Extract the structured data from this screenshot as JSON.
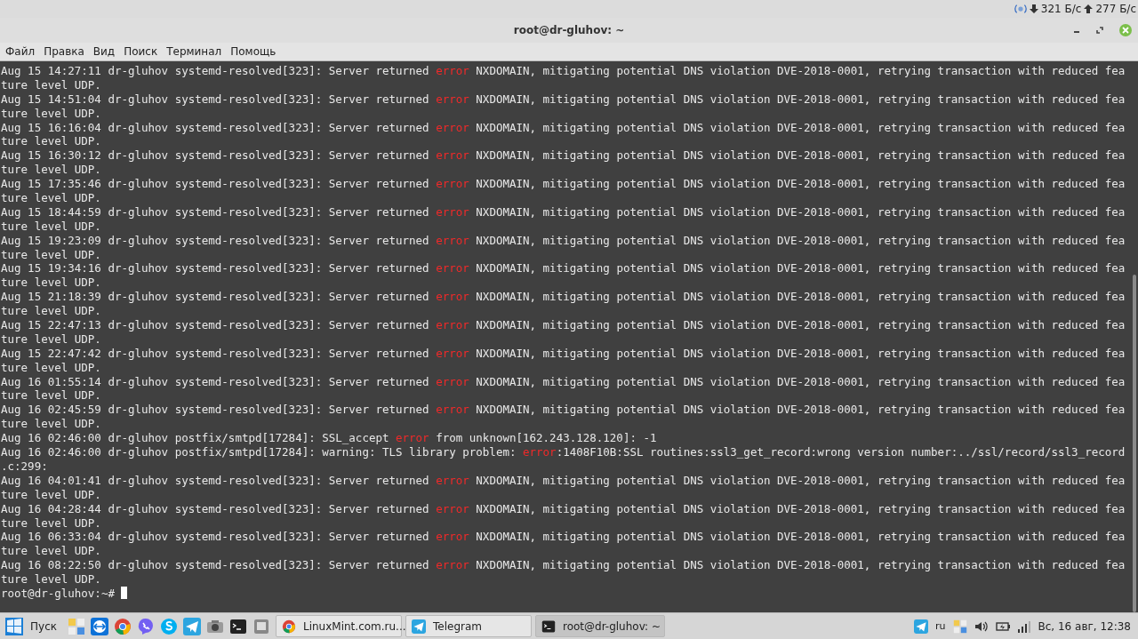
{
  "top_panel": {
    "download": "321 Б/с",
    "upload": "277 Б/с"
  },
  "window": {
    "title": "root@dr-gluhov: ~"
  },
  "menu": [
    "Файл",
    "Правка",
    "Вид",
    "Поиск",
    "Терминал",
    "Помощь"
  ],
  "terminal": {
    "rows": [
      {
        "pre": "Aug 15 14:27:11 dr-gluhov systemd-resolved[323]: Server returned ",
        "err": "error",
        "post": " NXDOMAIN, mitigating potential DNS violation DVE-2018-0001, retrying transaction with reduced fea"
      },
      {
        "pre": "ture level UDP."
      },
      {
        "pre": "Aug 15 14:51:04 dr-gluhov systemd-resolved[323]: Server returned ",
        "err": "error",
        "post": " NXDOMAIN, mitigating potential DNS violation DVE-2018-0001, retrying transaction with reduced fea"
      },
      {
        "pre": "ture level UDP."
      },
      {
        "pre": "Aug 15 16:16:04 dr-gluhov systemd-resolved[323]: Server returned ",
        "err": "error",
        "post": " NXDOMAIN, mitigating potential DNS violation DVE-2018-0001, retrying transaction with reduced fea"
      },
      {
        "pre": "ture level UDP."
      },
      {
        "pre": "Aug 15 16:30:12 dr-gluhov systemd-resolved[323]: Server returned ",
        "err": "error",
        "post": " NXDOMAIN, mitigating potential DNS violation DVE-2018-0001, retrying transaction with reduced fea"
      },
      {
        "pre": "ture level UDP."
      },
      {
        "pre": "Aug 15 17:35:46 dr-gluhov systemd-resolved[323]: Server returned ",
        "err": "error",
        "post": " NXDOMAIN, mitigating potential DNS violation DVE-2018-0001, retrying transaction with reduced fea"
      },
      {
        "pre": "ture level UDP."
      },
      {
        "pre": "Aug 15 18:44:59 dr-gluhov systemd-resolved[323]: Server returned ",
        "err": "error",
        "post": " NXDOMAIN, mitigating potential DNS violation DVE-2018-0001, retrying transaction with reduced fea"
      },
      {
        "pre": "ture level UDP."
      },
      {
        "pre": "Aug 15 19:23:09 dr-gluhov systemd-resolved[323]: Server returned ",
        "err": "error",
        "post": " NXDOMAIN, mitigating potential DNS violation DVE-2018-0001, retrying transaction with reduced fea"
      },
      {
        "pre": "ture level UDP."
      },
      {
        "pre": "Aug 15 19:34:16 dr-gluhov systemd-resolved[323]: Server returned ",
        "err": "error",
        "post": " NXDOMAIN, mitigating potential DNS violation DVE-2018-0001, retrying transaction with reduced fea"
      },
      {
        "pre": "ture level UDP."
      },
      {
        "pre": "Aug 15 21:18:39 dr-gluhov systemd-resolved[323]: Server returned ",
        "err": "error",
        "post": " NXDOMAIN, mitigating potential DNS violation DVE-2018-0001, retrying transaction with reduced fea"
      },
      {
        "pre": "ture level UDP."
      },
      {
        "pre": "Aug 15 22:47:13 dr-gluhov systemd-resolved[323]: Server returned ",
        "err": "error",
        "post": " NXDOMAIN, mitigating potential DNS violation DVE-2018-0001, retrying transaction with reduced fea"
      },
      {
        "pre": "ture level UDP."
      },
      {
        "pre": "Aug 15 22:47:42 dr-gluhov systemd-resolved[323]: Server returned ",
        "err": "error",
        "post": " NXDOMAIN, mitigating potential DNS violation DVE-2018-0001, retrying transaction with reduced fea"
      },
      {
        "pre": "ture level UDP."
      },
      {
        "pre": "Aug 16 01:55:14 dr-gluhov systemd-resolved[323]: Server returned ",
        "err": "error",
        "post": " NXDOMAIN, mitigating potential DNS violation DVE-2018-0001, retrying transaction with reduced fea"
      },
      {
        "pre": "ture level UDP."
      },
      {
        "pre": "Aug 16 02:45:59 dr-gluhov systemd-resolved[323]: Server returned ",
        "err": "error",
        "post": " NXDOMAIN, mitigating potential DNS violation DVE-2018-0001, retrying transaction with reduced fea"
      },
      {
        "pre": "ture level UDP."
      },
      {
        "pre": "Aug 16 02:46:00 dr-gluhov postfix/smtpd[17284]: SSL_accept ",
        "err": "error",
        "post": " from unknown[162.243.128.120]: -1"
      },
      {
        "pre": "Aug 16 02:46:00 dr-gluhov postfix/smtpd[17284]: warning: TLS library problem: ",
        "err": "error",
        "post": ":1408F10B:SSL routines:ssl3_get_record:wrong version number:../ssl/record/ssl3_record"
      },
      {
        "pre": ".c:299:"
      },
      {
        "pre": "Aug 16 04:01:41 dr-gluhov systemd-resolved[323]: Server returned ",
        "err": "error",
        "post": " NXDOMAIN, mitigating potential DNS violation DVE-2018-0001, retrying transaction with reduced fea"
      },
      {
        "pre": "ture level UDP."
      },
      {
        "pre": "Aug 16 04:28:44 dr-gluhov systemd-resolved[323]: Server returned ",
        "err": "error",
        "post": " NXDOMAIN, mitigating potential DNS violation DVE-2018-0001, retrying transaction with reduced fea"
      },
      {
        "pre": "ture level UDP."
      },
      {
        "pre": "Aug 16 06:33:04 dr-gluhov systemd-resolved[323]: Server returned ",
        "err": "error",
        "post": " NXDOMAIN, mitigating potential DNS violation DVE-2018-0001, retrying transaction with reduced fea"
      },
      {
        "pre": "ture level UDP."
      },
      {
        "pre": "Aug 16 08:22:50 dr-gluhov systemd-resolved[323]: Server returned ",
        "err": "error",
        "post": " NXDOMAIN, mitigating potential DNS violation DVE-2018-0001, retrying transaction with reduced fea"
      },
      {
        "pre": "ture level UDP."
      }
    ],
    "prompt": "root@dr-gluhov:~# "
  },
  "taskbar": {
    "start": "Пуск",
    "windows": [
      {
        "kind": "browser",
        "label": "LinuxMint.com.ru...",
        "selected": false
      },
      {
        "kind": "telegram",
        "label": "Telegram",
        "selected": false
      },
      {
        "kind": "terminal",
        "label": "root@dr-gluhov: ~",
        "selected": true
      }
    ],
    "layout": "ru",
    "clock": "Вс, 16 авг, 12:38"
  }
}
